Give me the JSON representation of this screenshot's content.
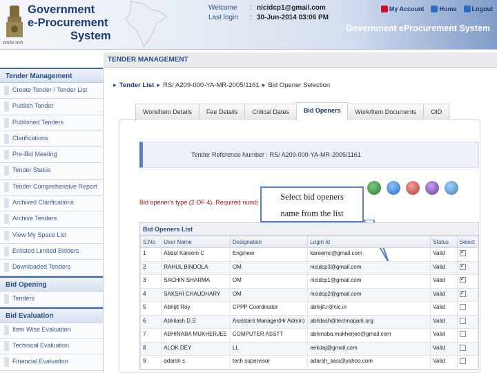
{
  "header": {
    "brand_line1": "Government",
    "brand_line2": "e-Procurement",
    "brand_line3": "System",
    "emblem_caption": "सत्यमेव जयते",
    "welcome_label": "Welcome",
    "welcome_value": "nicidcp1@gmail.com",
    "last_login_label": "Last login",
    "last_login_value": "30-Jun-2014 03:06 PM",
    "links": {
      "my_account": "My Account",
      "home": "Home",
      "logout": "Logout"
    },
    "title_right": "Government eProcurement System"
  },
  "section_title": "TENDER MANAGEMENT",
  "sidebar": {
    "groups": [
      {
        "title": "Tender Management",
        "items": [
          "Create Tender / Tender List",
          "Publish Tender",
          "Published Tenders",
          "Clarifications",
          "Pre-Bid Meeting",
          "Tender Status",
          "Tender Comprehensive Report",
          "Archived Clarifications",
          "Archive Tenders",
          "View My Space List",
          "Enlisted Limited Bidders",
          "Downloaded Tenders"
        ]
      },
      {
        "title": "Bid Opening",
        "items": [
          "Tenders"
        ]
      },
      {
        "title": "Bid Evaluation",
        "items": [
          "Item Wise Evaluation",
          "Technical Evaluation",
          "Financial Evaluation"
        ]
      }
    ]
  },
  "breadcrumb": {
    "root": "Tender List",
    "ref": "RS/ A209-000-YA-MR-2005/1161",
    "current": "Bid Opener Selection"
  },
  "tabs": [
    "Work/Item Details",
    "Fee Details",
    "Critical Dates",
    "Bid Openers",
    "Work/Item Documents",
    "OID"
  ],
  "active_tab": "Bid Openers",
  "tender_ref": {
    "label": "Tender Reference Number :",
    "value": "RS/ A209-000-YA-MR-2005/1161"
  },
  "opener_type_text": "Bid opener's type (2 OF 4). Required numb",
  "callout": {
    "line1": "Select bid openers",
    "line2": "name from the list"
  },
  "table": {
    "title": "Bid Openers List",
    "columns": [
      "S.No",
      "User Name",
      "Designation",
      "Login Id",
      "Status",
      "Select"
    ],
    "rows": [
      {
        "sno": "1",
        "name": "Abdul Kareem C",
        "designation": "Engineer",
        "login": "kareemc@gmail.com",
        "status": "Valid",
        "selected": true
      },
      {
        "sno": "2",
        "name": "RAHUL BINDOLA",
        "designation": "OM",
        "login": "nicidcp3@gmail.com",
        "status": "Valid",
        "selected": true
      },
      {
        "sno": "3",
        "name": "SACHIN SHARMA",
        "designation": "OM",
        "login": "nicidcp1@gmail.com",
        "status": "Valid",
        "selected": true
      },
      {
        "sno": "4",
        "name": "SAKSHI CHAUDHARY",
        "designation": "OM",
        "login": "nicidcp2@gmail.com",
        "status": "Valid",
        "selected": true
      },
      {
        "sno": "5",
        "name": "Abhijit Roy",
        "designation": "CPPP Coordinator",
        "login": "abhijit.r@nic.in",
        "status": "Valid",
        "selected": false
      },
      {
        "sno": "6",
        "name": "Abhilash D.S",
        "designation": "Assistant Manager(Hr Admin)",
        "login": "abhilash@technopark.org",
        "status": "Valid",
        "selected": false
      },
      {
        "sno": "7",
        "name": "ABHINABA MUKHERJEE",
        "designation": "COMPUTER ASSTT",
        "login": "abhinaba.mukherjee@gmail.com",
        "status": "Valid",
        "selected": false
      },
      {
        "sno": "8",
        "name": "ALOK DEY",
        "designation": "LL",
        "login": "eekdaj@gmail.com",
        "status": "Valid",
        "selected": false
      },
      {
        "sno": "9",
        "name": "adarsh s",
        "designation": "tech supervisor",
        "login": "adarsh_sasi@yahoo.com",
        "status": "Valid",
        "selected": false
      }
    ]
  },
  "colors": {
    "primary": "#1d3b74",
    "accent": "#5b7fbf",
    "header_right": "#7f9cc9"
  },
  "action_icons": [
    "user-group-icon",
    "user-icon",
    "users-add-icon",
    "users-icon",
    "user-remove-icon"
  ]
}
